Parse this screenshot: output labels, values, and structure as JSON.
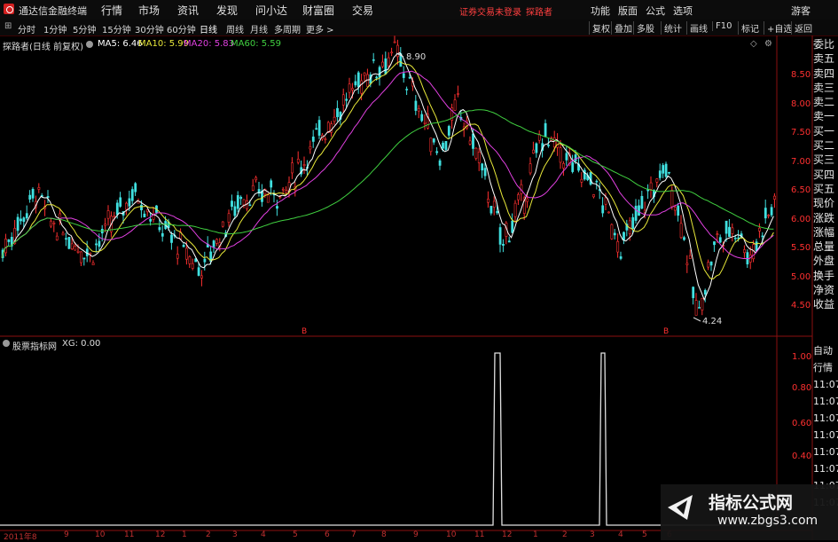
{
  "app": {
    "name": "通达信金融终端"
  },
  "menu": [
    "行情",
    "市场",
    "资讯",
    "发现",
    "问小达",
    "财富圈",
    "交易"
  ],
  "notice": [
    "证券交易未登录",
    "探路者"
  ],
  "right_menu": [
    "功能",
    "版面",
    "公式",
    "选项"
  ],
  "user": "游客",
  "toolbar": {
    "periods": [
      "分时",
      "1分钟",
      "5分钟",
      "15分钟",
      "30分钟",
      "60分钟",
      "日线",
      "周线",
      "月线",
      "多周期",
      "更多 >"
    ],
    "active": "日线",
    "right": [
      "复权",
      "叠加",
      "多股",
      "统计",
      "画线",
      "F10",
      "标记",
      "+自选",
      "返回"
    ]
  },
  "main": {
    "title": "探路者(日线 前复权)",
    "ma": [
      {
        "label": "MA5: 6.46",
        "color": "#ffffff"
      },
      {
        "label": "MA10: 5.99",
        "color": "#e8e83a"
      },
      {
        "label": "MA20: 5.83",
        "color": "#e040e0"
      },
      {
        "label": "MA60: 5.59",
        "color": "#40d040"
      }
    ],
    "high_label": "8.90",
    "low_label": "4.24",
    "price_ticks": [
      "8.50",
      "8.00",
      "7.50",
      "7.00",
      "6.50",
      "6.00",
      "5.50",
      "5.00",
      "4.50"
    ],
    "markers": [
      "B",
      "B"
    ]
  },
  "sub": {
    "title": "股票指标网",
    "xg": "XG: 0.00",
    "ticks": [
      "1.00",
      "0.80",
      "0.60",
      "0.40"
    ]
  },
  "date_axis": [
    "2011年8",
    "9",
    "10",
    "11",
    "12",
    "1",
    "2",
    "3",
    "4",
    "5",
    "6",
    "7",
    "8",
    "9",
    "10",
    "11",
    "12",
    "1",
    "2",
    "3",
    "4",
    "5",
    "6"
  ],
  "sidebar": [
    "委比",
    "卖五",
    "卖四",
    "卖三",
    "卖二",
    "卖一",
    "买一",
    "买二",
    "买三",
    "买四",
    "买五",
    "现价",
    "涨跌",
    "涨幅",
    "总量",
    "外盘",
    "换手",
    "净资",
    "收益"
  ],
  "sidebar2": [
    "自动",
    "行情",
    "11:07",
    "11:07",
    "11:07",
    "11:07",
    "11:07",
    "11:07",
    "11:07",
    "11:07"
  ],
  "watermark": {
    "title": "指标公式网",
    "url": "www.zbgs3.com"
  },
  "colors": {
    "up": "#ff3030",
    "down": "#40e0e0",
    "frame": "#8b1010",
    "ma5": "#ffffff",
    "ma10": "#e8e83a",
    "ma20": "#e040e0",
    "ma60": "#40d040"
  }
}
